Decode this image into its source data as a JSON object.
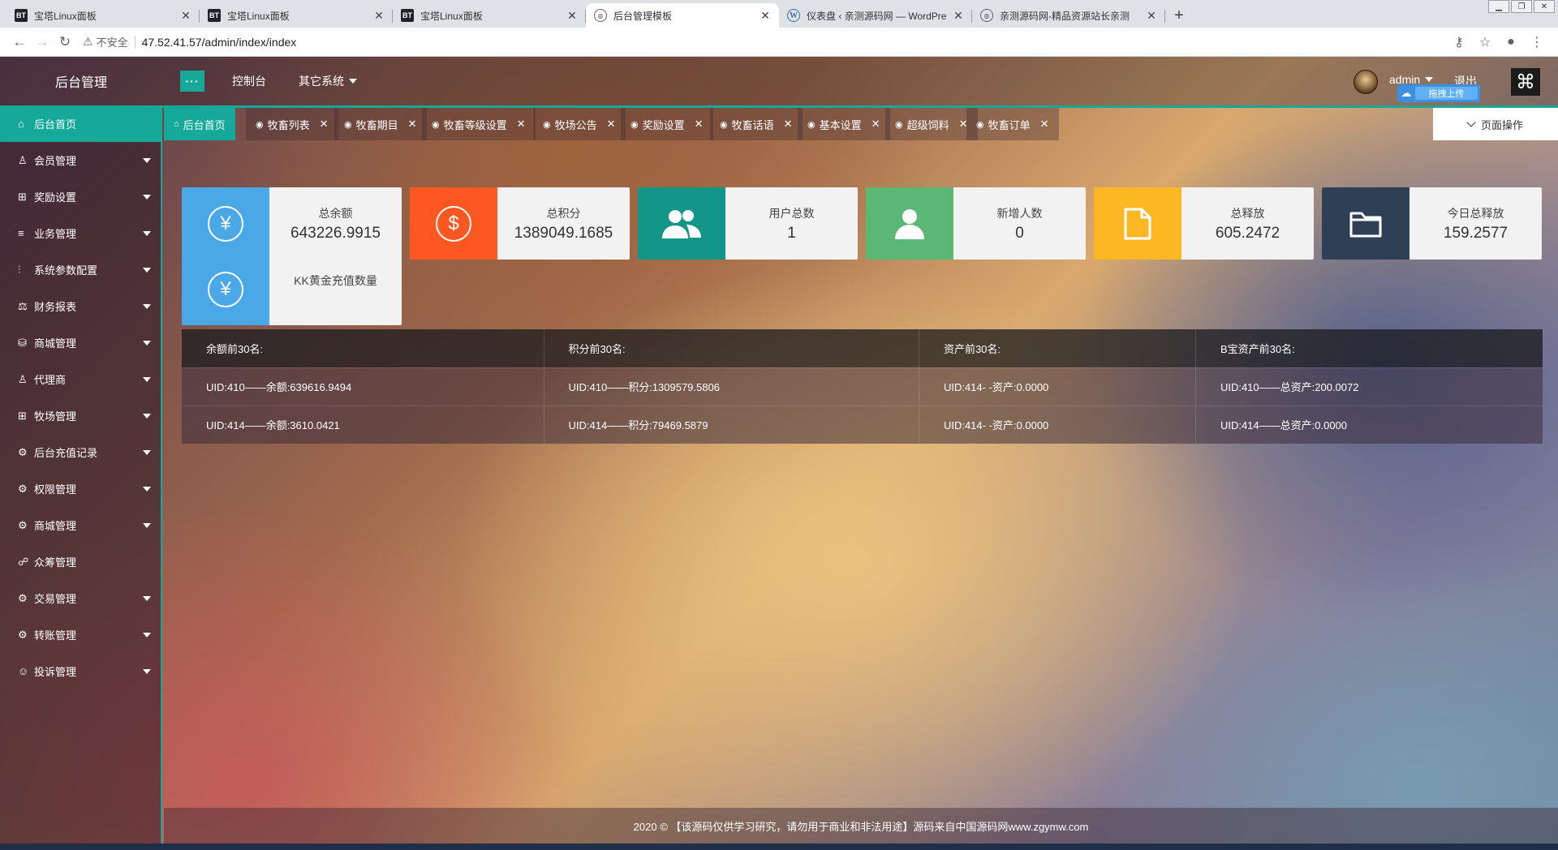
{
  "browser": {
    "tabs": [
      {
        "favicon": "bt",
        "title": "宝塔Linux面板",
        "active": false
      },
      {
        "favicon": "bt",
        "title": "宝塔Linux面板",
        "active": false
      },
      {
        "favicon": "bt",
        "title": "宝塔Linux面板",
        "active": false
      },
      {
        "favicon": "globe",
        "title": "后台管理模板",
        "active": true
      },
      {
        "favicon": "wp",
        "title": "仪表盘 ‹ 亲测源码网 — WordPre",
        "active": false
      },
      {
        "favicon": "globe",
        "title": "亲测源码网-精品资源站长亲测",
        "active": false
      }
    ],
    "security_label": "不安全",
    "url": "47.52.41.57/admin/index/index"
  },
  "header": {
    "logo": "后台管理",
    "menu_toggle": "···",
    "nav": {
      "console": "控制台",
      "other": "其它系统"
    },
    "user": "admin",
    "logout": "退出",
    "upload_badge": "拖拽上传"
  },
  "sidebar": {
    "items": [
      {
        "icon": "home-icon",
        "glyph": "⌂",
        "label": "后台首页",
        "active": true,
        "has_sub": false
      },
      {
        "icon": "user-icon",
        "glyph": "♙",
        "label": "会员管理",
        "has_sub": true
      },
      {
        "icon": "gift-icon",
        "glyph": "⊞",
        "label": "奖励设置",
        "has_sub": true
      },
      {
        "icon": "list-icon",
        "glyph": "≡",
        "label": "业务管理",
        "has_sub": true
      },
      {
        "icon": "sliders-icon",
        "glyph": "⫶",
        "label": "系统参数配置",
        "has_sub": true
      },
      {
        "icon": "scale-icon",
        "glyph": "⚖",
        "label": "财务报表",
        "has_sub": true
      },
      {
        "icon": "store-icon",
        "glyph": "⛁",
        "label": "商城管理",
        "has_sub": true
      },
      {
        "icon": "user-icon",
        "glyph": "♙",
        "label": "代理商",
        "has_sub": true
      },
      {
        "icon": "gift-icon",
        "glyph": "⊞",
        "label": "牧场管理",
        "has_sub": true
      },
      {
        "icon": "gear-icon",
        "glyph": "⚙",
        "label": "后台充值记录",
        "has_sub": true
      },
      {
        "icon": "gear-icon",
        "glyph": "⚙",
        "label": "权限管理",
        "has_sub": true
      },
      {
        "icon": "gear-icon",
        "glyph": "⚙",
        "label": "商城管理",
        "has_sub": true
      },
      {
        "icon": "crowd-icon",
        "glyph": "☍",
        "label": "众筹管理",
        "has_sub": false
      },
      {
        "icon": "gear-icon",
        "glyph": "⚙",
        "label": "交易管理",
        "has_sub": true
      },
      {
        "icon": "gear-icon",
        "glyph": "⚙",
        "label": "转账管理",
        "has_sub": true
      },
      {
        "icon": "smile-icon",
        "glyph": "☺",
        "label": "投诉管理",
        "has_sub": true
      }
    ]
  },
  "page_tabs": [
    {
      "label": "后台首页",
      "closable": false
    },
    {
      "label": "牧畜列表",
      "closable": true
    },
    {
      "label": "牧畜期目",
      "closable": true
    },
    {
      "label": "牧畜等级设置",
      "closable": true
    },
    {
      "label": "牧场公告",
      "closable": true
    },
    {
      "label": "奖励设置",
      "closable": true
    },
    {
      "label": "牧畜话语",
      "closable": true
    },
    {
      "label": "基本设置",
      "closable": true
    },
    {
      "label": "超级饲料",
      "closable": true
    },
    {
      "label": "牧畜订单",
      "closable": true
    }
  ],
  "page_ops": "页面操作",
  "stats": [
    {
      "icon": "yen-icon",
      "glyph": "¥",
      "color": "#4aa8e6",
      "label": "总余额",
      "value": "643226.9915"
    },
    {
      "icon": "dollar-icon",
      "glyph": "$",
      "color": "#fd5722",
      "label": "总积分",
      "value": "1389049.1685"
    },
    {
      "icon": "users-icon",
      "glyph": "",
      "color": "#119688",
      "label": "用户总数",
      "value": "1"
    },
    {
      "icon": "user-add-icon",
      "glyph": "",
      "color": "#5bb774",
      "label": "新增人数",
      "value": "0"
    },
    {
      "icon": "file-icon",
      "glyph": "",
      "color": "#fbb824",
      "label": "总释放",
      "value": "605.2472"
    },
    {
      "icon": "folder-icon",
      "glyph": "",
      "color": "#2f4056",
      "label": "今日总释放",
      "value": "159.2577"
    },
    {
      "icon": "yen-icon",
      "glyph": "¥",
      "color": "#4aa8e6",
      "label": "KK黄金充值数量",
      "value": ""
    }
  ],
  "rank_table": {
    "headers": [
      "余额前30名:",
      "积分前30名:",
      "资产前30名:",
      "B宝资产前30名:"
    ],
    "rows": [
      [
        "UID:410——余额:639616.9494",
        "UID:410——积分:1309579.5806",
        "UID:414- -资产:0.0000",
        "UID:410——总资产:200.0072"
      ],
      [
        "UID:414——余额:3610.0421",
        "UID:414——积分:79469.5879",
        "UID:414- -资产:0.0000",
        "UID:414——总资产:0.0000"
      ]
    ]
  },
  "footer": "2020 © 【该源码仅供学习研究，请勿用于商业和非法用途】源码来自中国源码网www.zgymw.com"
}
